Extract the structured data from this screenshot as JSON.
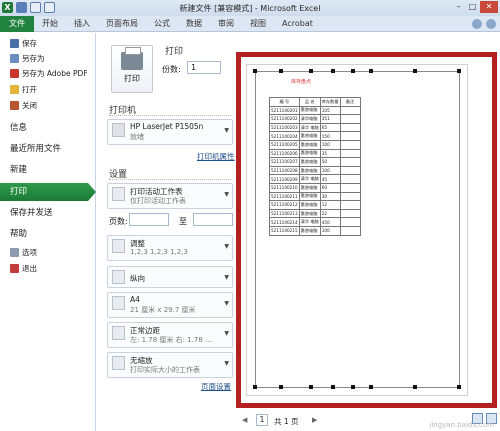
{
  "window": {
    "title": "新建文件 [兼容模式] - Microsoft Excel"
  },
  "ribbon_tabs": [
    "文件",
    "开始",
    "插入",
    "页面布局",
    "公式",
    "数据",
    "审阅",
    "视图",
    "Acrobat"
  ],
  "nav": {
    "items": [
      {
        "label": "保存",
        "icon": "save-icon"
      },
      {
        "label": "另存为",
        "icon": "save-as-icon"
      },
      {
        "label": "另存为 Adobe PDF",
        "icon": "pdf-icon"
      },
      {
        "label": "打开",
        "icon": "open-folder-icon"
      },
      {
        "label": "关闭",
        "icon": "close-file-icon"
      }
    ],
    "info": "信息",
    "recent": "最近所用文件",
    "new": "新建",
    "print": "打印",
    "save_send": "保存并发送",
    "help": "帮助",
    "options": "选项",
    "exit": "退出"
  },
  "print_panel": {
    "heading": "打印",
    "print_button": "打印",
    "copies_label": "份数:",
    "copies_value": "1",
    "printer_heading": "打印机",
    "printer_name": "HP LaserJet P1505n",
    "printer_status": "就绪",
    "printer_props": "打印机属性",
    "settings_heading": "设置",
    "active_sheet_title": "打印活动工作表",
    "active_sheet_sub": "仅打印活动工作表",
    "pages_label": "页数:",
    "to_label": "至",
    "collate_title": "调整",
    "collate_sub": "1,2,3    1,2,3    1,2,3",
    "orientation": "纵向",
    "paper_title": "A4",
    "paper_sub": "21 厘米 x 29.7 厘米",
    "margins_title": "正常边距",
    "margins_sub": "左: 1.78 厘米   右: 1.78 ...",
    "scaling_title": "无缩放",
    "scaling_sub": "打印实际大小的工作表",
    "page_setup": "页面设置"
  },
  "preview": {
    "sheet_title": "库存盘点",
    "headers": [
      "编 号",
      "品 名",
      "库存数量",
      "备注"
    ],
    "rows": [
      [
        "5211100201",
        "惠普电脑",
        "105",
        ""
      ],
      [
        "5211100202",
        "清华电脑",
        "351",
        ""
      ],
      [
        "5211100203",
        "清华 电脑",
        "65",
        ""
      ],
      [
        "5211100204",
        "惠普电脑",
        "150",
        ""
      ],
      [
        "5211100205",
        "惠普电脑",
        "100",
        ""
      ],
      [
        "5211100206",
        "惠普电脑",
        "35",
        ""
      ],
      [
        "5211100207",
        "惠普电脑",
        "50",
        ""
      ],
      [
        "5211100208",
        "惠普电脑",
        "100",
        ""
      ],
      [
        "5211100209",
        "清华 电脑",
        "45",
        ""
      ],
      [
        "5211100210",
        "惠普电脑",
        "60",
        ""
      ],
      [
        "5211100211",
        "惠普电脑",
        "30",
        ""
      ],
      [
        "5211100212",
        "惠普电脑",
        "12",
        ""
      ],
      [
        "5211100213",
        "惠普电脑",
        "22",
        ""
      ],
      [
        "5211100214",
        "清华 电脑",
        "450",
        ""
      ],
      [
        "5211100215",
        "惠普电脑",
        "100",
        ""
      ]
    ]
  },
  "status": {
    "page_current": "1",
    "page_total": "共 1 页"
  },
  "watermark": "jingyan.baidu.com",
  "colors": {
    "accent_green": "#21833f",
    "highlight_red": "#b41f1f"
  }
}
